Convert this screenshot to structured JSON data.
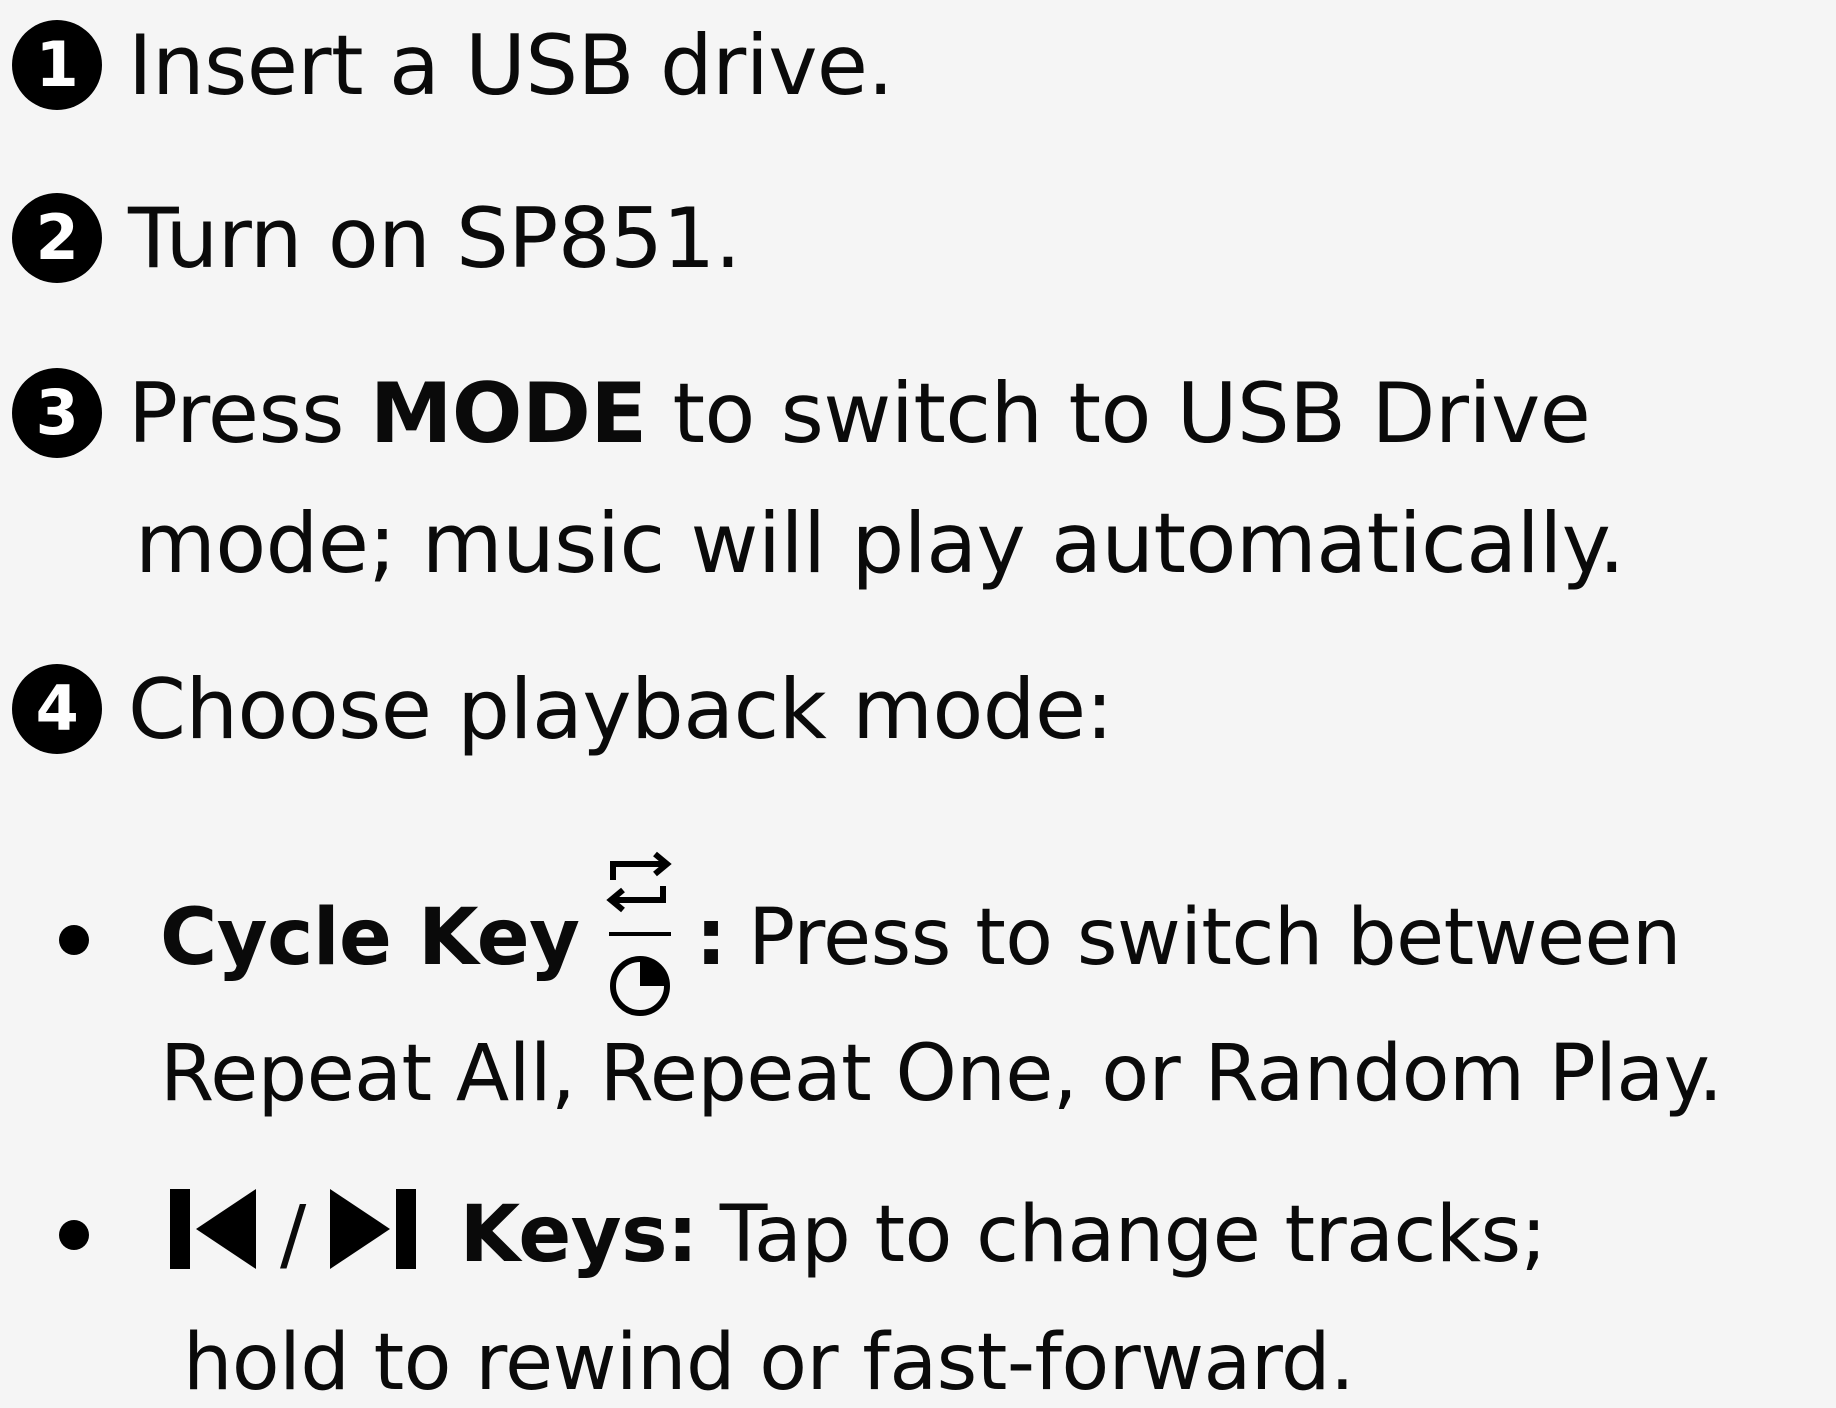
{
  "steps": [
    {
      "number": "1",
      "text": "Insert a USB drive."
    },
    {
      "number": "2",
      "text": "Turn on SP851."
    },
    {
      "number": "3",
      "text_before": "Press ",
      "bold": "MODE",
      "text_after": " to switch to USB Drive",
      "continuation": "mode; music will play automatically."
    },
    {
      "number": "4",
      "text": "Choose playback mode:"
    }
  ],
  "bullets": {
    "cycle": {
      "label": "Cycle Key",
      "colon": ":",
      "text": "Press to switch between",
      "continuation": "Repeat All, Repeat One, or Random Play."
    },
    "tracks": {
      "slash": "/",
      "label": "Keys:",
      "text": "Tap to change tracks;",
      "continuation": "hold to rewind or fast-forward."
    }
  },
  "icons": {
    "cycle": "repeat-timer-icon",
    "previous": "skip-previous-icon",
    "next": "skip-next-icon"
  }
}
